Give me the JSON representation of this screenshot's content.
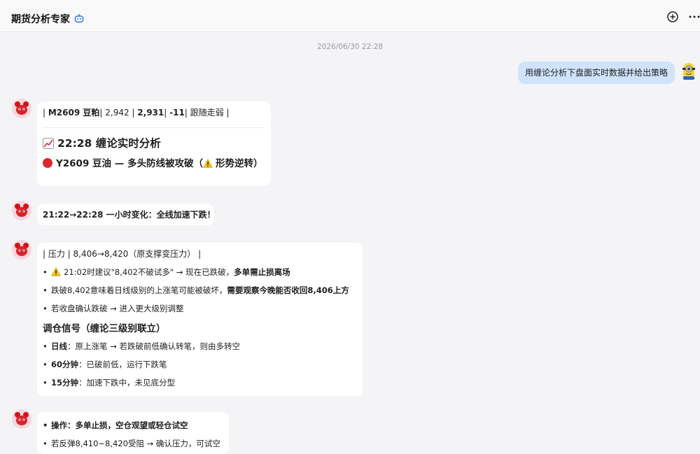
{
  "header": {
    "title": "期货分析专家",
    "icons": [
      "bot-icon",
      "add-circle-icon",
      "more-icon"
    ]
  },
  "timestamp": "2026/06/30 22:28",
  "user_message": {
    "text": "用缠论分析下盘面实时数据并给出策略",
    "avatar": "minion-avatar"
  },
  "messages": {
    "m1": {
      "table_row": {
        "p1": "| ",
        "symbol": "M2609 豆粕",
        "p2": "| 2,942 | ",
        "price": "2,931",
        "p3": "| ",
        "change": "-11",
        "p4": "| 跟随走弱 |"
      },
      "heading": "22:28 缠论实时分析",
      "subheading_pre": "Y2609 豆油 — 多头防线被攻破（",
      "subheading_post": "形势逆转）"
    },
    "m2": {
      "text": "21:22→22:28 一小时变化：全线加速下跌！"
    },
    "m3": {
      "table_row": "| 压力 | 8,406→8,420（原支撑变压力） |",
      "bullets": [
        {
          "pre": "21:02时建议\"8,402不破试多\" → 现在已跌破，",
          "bold": "多单需止损离场"
        },
        {
          "pre": "跌破8,402意味着日线级别的上涨笔可能被破坏，",
          "bold": "需要观察今晚能否收回8,406上方"
        },
        {
          "pre": "若收盘确认跌破 → 进入更大级别调整",
          "bold": ""
        }
      ],
      "section_title": "调仓信号（缠论三级别联立）",
      "signals": [
        {
          "label": "日线",
          "text": "：原上涨笔 → 若跌破前低确认转笔，则由多转空"
        },
        {
          "label": "60分钟",
          "text": "：已破前低，运行下跌笔"
        },
        {
          "label": "15分钟",
          "text": "：加速下跌中，未见底分型"
        }
      ]
    },
    "m4": {
      "op_label": "操作：多单止损，空仓观望或轻仓试空",
      "line2": "若反弹8,410~8,420受阻 → 确认压力，可试空"
    }
  },
  "colors": {
    "bg": "#f4f4f6",
    "user_bubble": "#cfe4fb",
    "bot_bubble": "#ffffff",
    "red": "#e0242e"
  }
}
